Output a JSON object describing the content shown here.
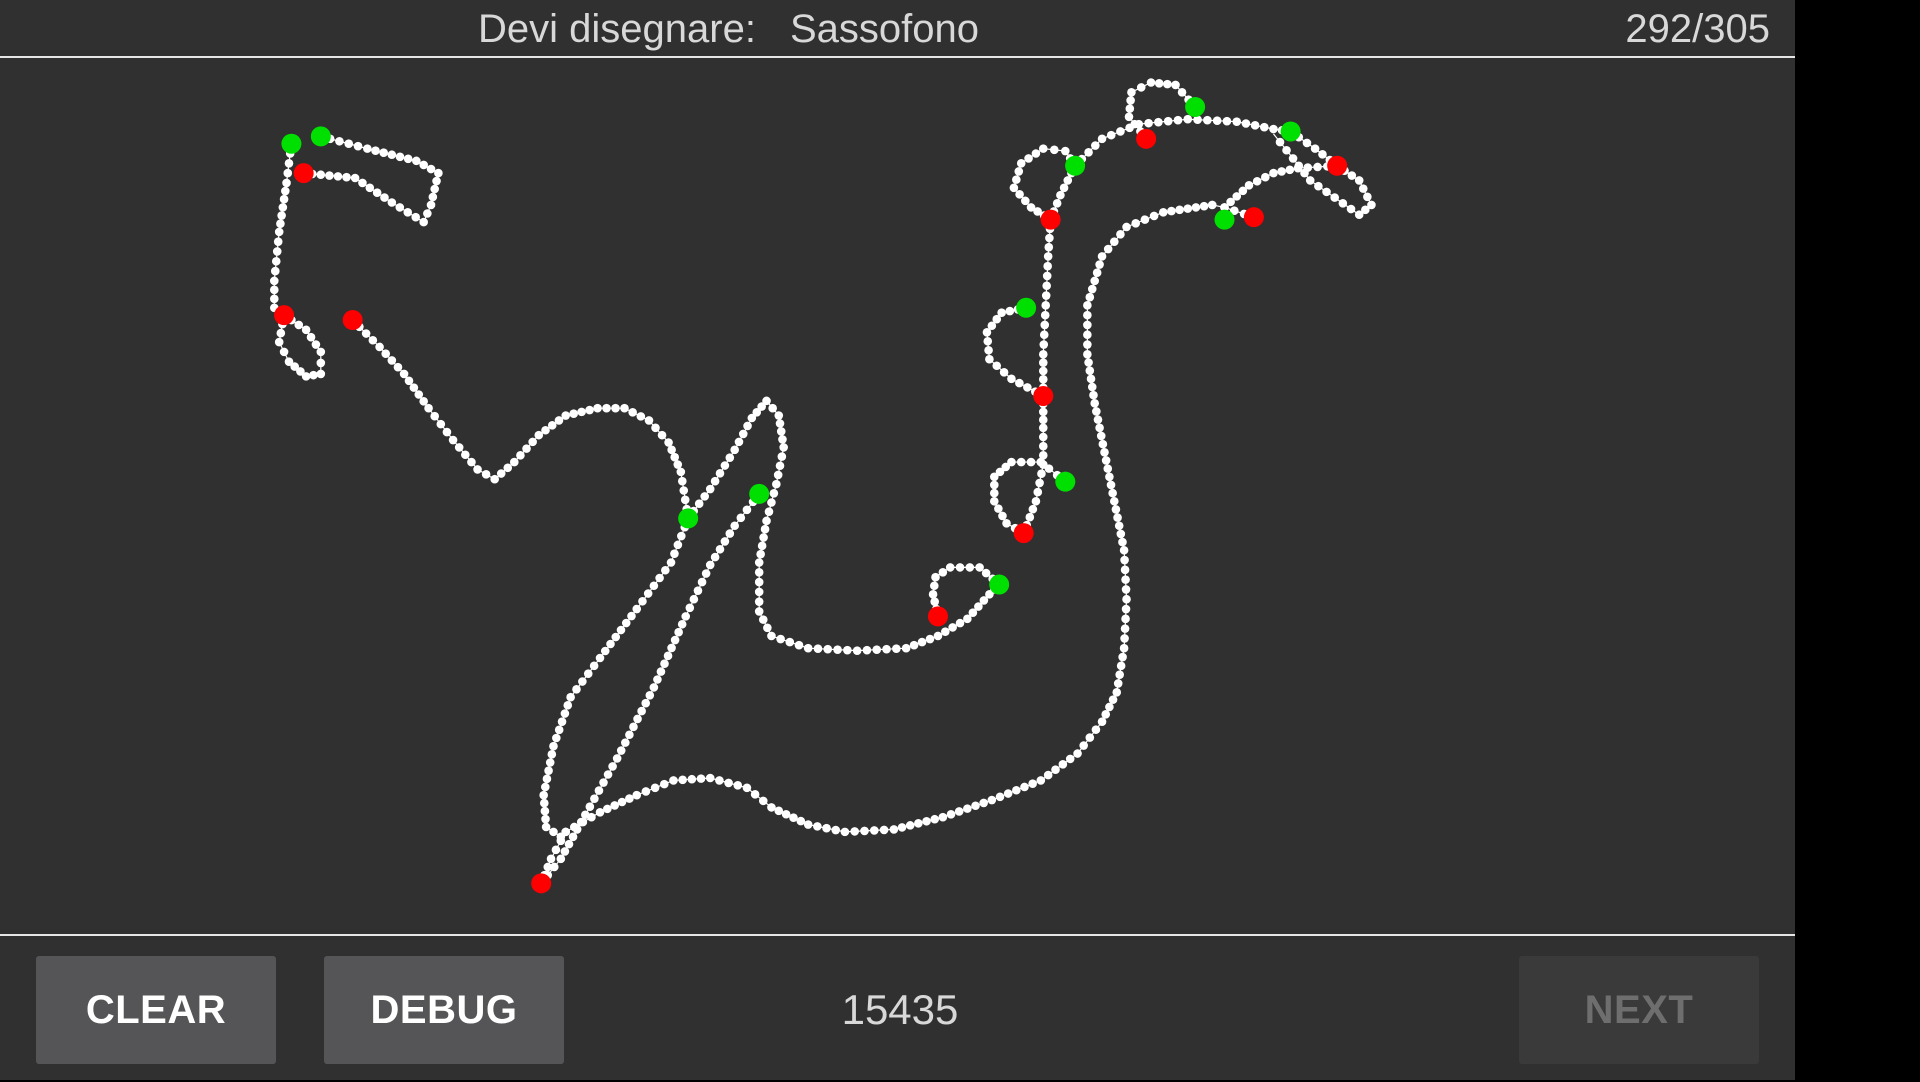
{
  "header": {
    "prompt_label": "Devi disegnare:",
    "prompt_word": "Sassofono",
    "counter": "292/305"
  },
  "footer": {
    "clear_label": "CLEAR",
    "debug_label": "DEBUG",
    "score": "15435",
    "next_label": "NEXT",
    "next_enabled": false
  },
  "canvas": {
    "background": "#303030",
    "stroke_color": "#ffffff",
    "stroke_start_color": "#00e000",
    "stroke_end_color": "#ff0000"
  }
}
